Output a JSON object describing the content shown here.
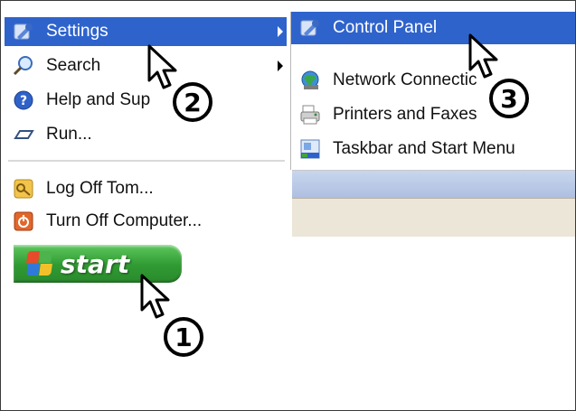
{
  "start_menu": {
    "items": [
      {
        "label": "Settings",
        "icon": "settings-icon"
      },
      {
        "label": "Search",
        "icon": "search-icon"
      },
      {
        "label": "Help and Sup",
        "icon": "help-icon"
      },
      {
        "label": "Run...",
        "icon": "run-icon"
      },
      {
        "label": "Log Off Tom...",
        "icon": "log-off-icon"
      },
      {
        "label": "Turn Off Computer...",
        "icon": "power-icon"
      }
    ]
  },
  "submenu": {
    "items": [
      {
        "label": "Control Panel",
        "icon": "control-panel-icon"
      },
      {
        "label": "Network Connectic",
        "icon": "network-icon"
      },
      {
        "label": "Printers and Faxes",
        "icon": "printer-icon"
      },
      {
        "label": "Taskbar and Start Menu",
        "icon": "taskbar-icon"
      }
    ]
  },
  "start_button": {
    "label": "start"
  },
  "steps": [
    "1",
    "2",
    "3"
  ],
  "colors": {
    "highlight": "#2f63cc",
    "start_green": "#2f9a32"
  }
}
